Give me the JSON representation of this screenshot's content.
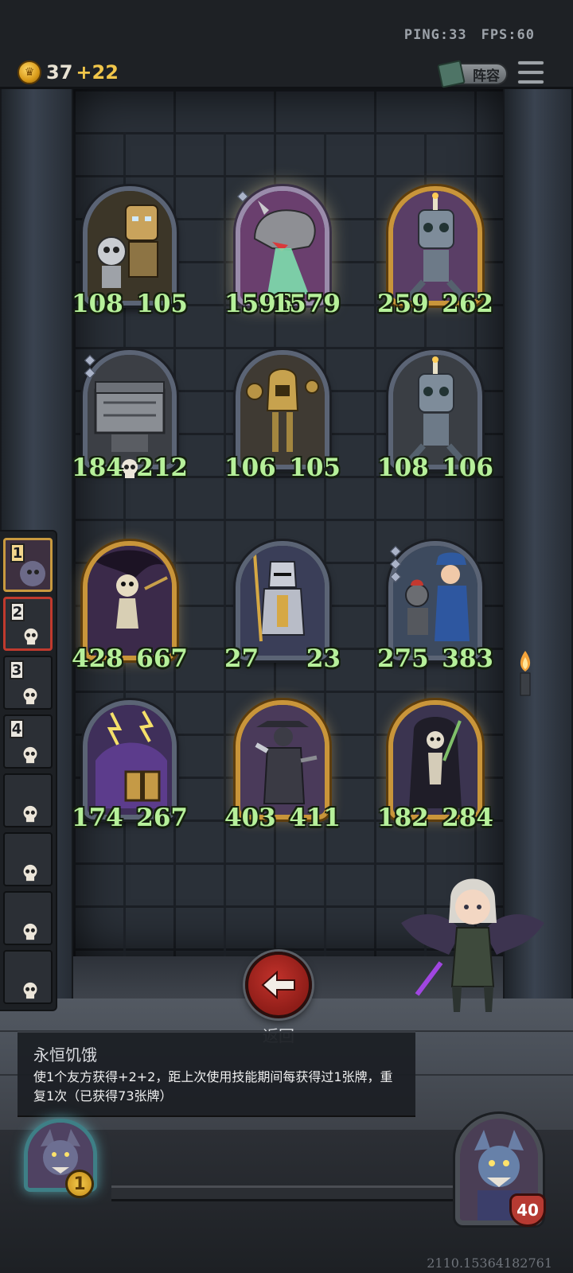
{
  "network": {
    "ping": "PING:33",
    "fps": "FPS:60"
  },
  "gold": {
    "amount": "37",
    "income": "+22"
  },
  "buttons": {
    "lineup": "阵容",
    "back": "返回"
  },
  "board": {
    "cards": [
      {
        "atk": "108",
        "hp": "105",
        "desc": "robot-duo"
      },
      {
        "atk": "1596",
        "hp": "1579",
        "desc": "dragon-breath"
      },
      {
        "atk": "259",
        "hp": "262",
        "desc": "candle-robot"
      },
      {
        "atk": "184",
        "hp": "212",
        "desc": "metal-crate"
      },
      {
        "atk": "106",
        "hp": "105",
        "desc": "brass-robot"
      },
      {
        "atk": "108",
        "hp": "106",
        "desc": "candle-robot-2"
      },
      {
        "atk": "428",
        "hp": "667",
        "desc": "skeleton-reaper"
      },
      {
        "atk": "27",
        "hp": "23",
        "desc": "armored-knight"
      },
      {
        "atk": "275",
        "hp": "383",
        "desc": "mechanic-girl"
      },
      {
        "atk": "174",
        "hp": "267",
        "desc": "treasure-mimic"
      },
      {
        "atk": "403",
        "hp": "411",
        "desc": "gunslinger"
      },
      {
        "atk": "182",
        "hp": "284",
        "desc": "grim-reaper"
      }
    ]
  },
  "sidebar": {
    "slots": [
      {
        "number": "1"
      },
      {
        "number": "2"
      },
      {
        "number": "3"
      },
      {
        "number": "4"
      },
      {
        "number": ""
      },
      {
        "number": ""
      },
      {
        "number": ""
      },
      {
        "number": ""
      }
    ]
  },
  "skill": {
    "title": "永恒饥饿",
    "description": "使1个友方获得+2+2，距上次使用技能期间每获得过1张牌，重复1次（已获得73张牌）"
  },
  "player": {
    "level": "1"
  },
  "opponent": {
    "health": "40"
  },
  "seed": "2110.15364182761",
  "colors": {
    "stat_text": "#b6f09a",
    "gold_frame": "#c9953a",
    "back_button": "#c2322b"
  }
}
